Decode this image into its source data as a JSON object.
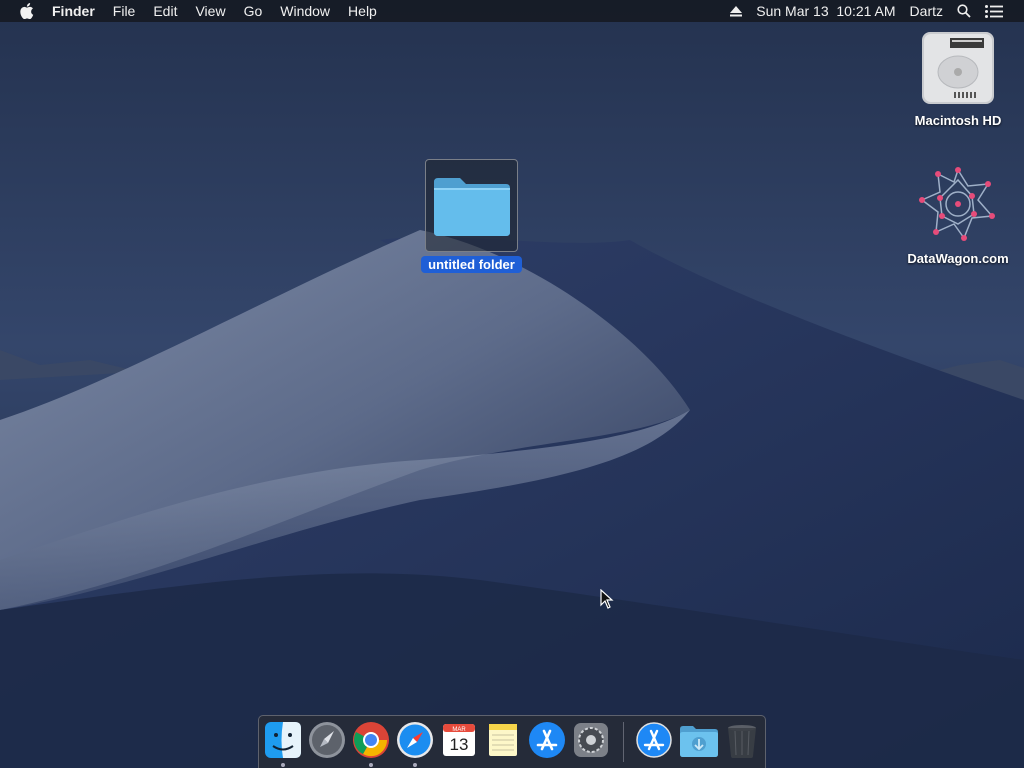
{
  "menubar": {
    "app_name": "Finder",
    "menus": [
      "File",
      "Edit",
      "View",
      "Go",
      "Window",
      "Help"
    ],
    "clock": "Sun Mar 13  10:21 AM",
    "user": "Dartz"
  },
  "desktop": {
    "selected_folder": "untitled folder",
    "drive_label": "Macintosh HD",
    "website_label": "DataWagon.com"
  },
  "dock": {
    "calendar_month": "MAR",
    "calendar_day": "13",
    "items": [
      "finder-icon",
      "launchpad-icon",
      "chrome-icon",
      "safari-icon",
      "calendar-icon",
      "notes-icon",
      "app-store-icon",
      "system-preferences-icon",
      "app-store-downloads-icon",
      "downloads-folder-icon",
      "trash-icon"
    ]
  },
  "colors": {
    "selection_blue": "#1f5fd6",
    "folder_blue": "#5fb7e6",
    "menubar_bg": "#161a24"
  }
}
